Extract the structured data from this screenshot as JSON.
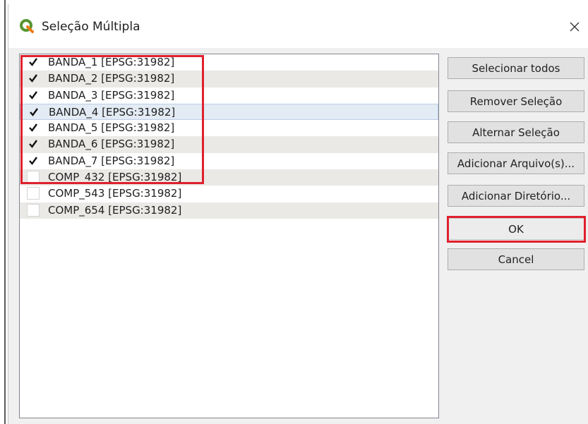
{
  "window": {
    "title": "Seleção Múltipla",
    "close_glyph": "×"
  },
  "colors": {
    "highlight": "#e0202e",
    "qgis_green": "#589632",
    "qgis_yellow": "#ee7913"
  },
  "icons": {
    "logo": "qgis-logo-icon",
    "close": "close-icon",
    "check": "checkmark-icon"
  },
  "layers": [
    {
      "label": "BANDA_1 [EPSG:31982]",
      "checked": true
    },
    {
      "label": "BANDA_2 [EPSG:31982]",
      "checked": true
    },
    {
      "label": "BANDA_3 [EPSG:31982]",
      "checked": true
    },
    {
      "label": "BANDA_4 [EPSG:31982]",
      "checked": true
    },
    {
      "label": "BANDA_5 [EPSG:31982]",
      "checked": true
    },
    {
      "label": "BANDA_6 [EPSG:31982]",
      "checked": true
    },
    {
      "label": "BANDA_7 [EPSG:31982]",
      "checked": true
    },
    {
      "label": "COMP_432 [EPSG:31982]",
      "checked": false
    },
    {
      "label": "COMP_543 [EPSG:31982]",
      "checked": false
    },
    {
      "label": "COMP_654 [EPSG:31982]",
      "checked": false
    }
  ],
  "buttons": {
    "select_all": "Selecionar todos",
    "remove_selection": "Remover Seleção",
    "toggle_selection": "Alternar Seleção",
    "add_files": "Adicionar Arquivo(s)...",
    "add_directory": "Adicionar Diretório...",
    "ok": "OK",
    "cancel": "Cancel"
  }
}
